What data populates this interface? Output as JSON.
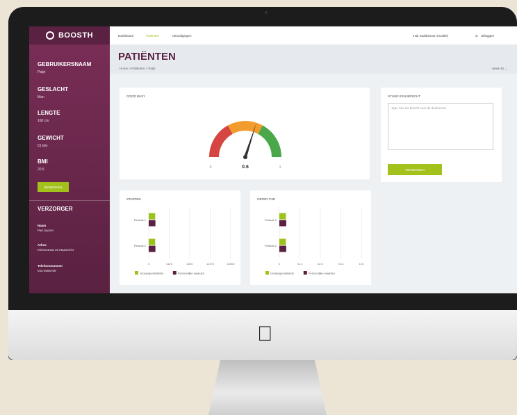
{
  "app": {
    "logo_text": "BOOSTH"
  },
  "topnav": {
    "items": [
      "Dashboard",
      "Patiënten",
      "Uitnodigingen"
    ],
    "user": "Inuk Stubbesoon (mobile)",
    "logout": "Uitloggen"
  },
  "header": {
    "title": "PATIËNTEN",
    "breadcrumb": [
      "Home",
      "Patiënten",
      "Patje"
    ],
    "week": "week 46"
  },
  "patient": {
    "username_label": "GEBRUIKERSNAAM",
    "username": "Patje",
    "gender_label": "GESLACHT",
    "gender": "Man",
    "length_label": "LENGTE",
    "length": "160 cm",
    "weight_label": "GEWICHT",
    "weight": "51 kilo",
    "bmi_label": "BMI",
    "bmi": "20,5",
    "edit_button": "BEWERKEN"
  },
  "caregiver": {
    "title": "VERZORGER",
    "name_label": "Naam",
    "name": "Piet Sanzer",
    "address_label": "Adres",
    "address": "Kleinestraat 25 Maastricht",
    "phone_label": "Telefoonnummer",
    "phone": "043-5656789"
  },
  "message": {
    "title": "STUUR EEN BERICHT",
    "placeholder": "Type hier uw bericht voor de deelnemer",
    "send_button": "VERZENDEN"
  },
  "chart_data": [
    {
      "type": "gauge",
      "title": "GOOD BUSY",
      "value": 0.6,
      "value_label": "0.6",
      "min": 0,
      "max": 1,
      "min_label": "0",
      "max_label": "1",
      "colors": [
        "#d64541",
        "#f39c2e",
        "#4aa84a"
      ]
    },
    {
      "type": "bar",
      "orientation": "horizontal",
      "title": "STAPPEN",
      "categories": [
        "Periode 1",
        "Periode 2"
      ],
      "series": [
        {
          "name": "Groepsgemiddelde",
          "color": "#9bc31a",
          "values": [
            1300,
            1300
          ]
        },
        {
          "name": "Persoonlijke waarden",
          "color": "#5b2142",
          "values": [
            1350,
            1350
          ]
        }
      ],
      "xticks": [
        "0",
        "4125",
        "8250",
        "12375",
        "16500"
      ],
      "xlim": [
        0,
        16500
      ]
    },
    {
      "type": "bar",
      "orientation": "horizontal",
      "title": "OEFEN TIJD",
      "categories": [
        "Periode 1",
        "Periode 2"
      ],
      "series": [
        {
          "name": "Groepsgemiddelde",
          "color": "#9bc31a",
          "values": [
            10,
            10
          ]
        },
        {
          "name": "Persoonlijke waarden",
          "color": "#5b2142",
          "values": [
            10.5,
            10.5
          ]
        }
      ],
      "xticks": [
        "0",
        "31.3",
        "62.5",
        "93.8",
        "125"
      ],
      "xlim": [
        0,
        125
      ]
    }
  ]
}
